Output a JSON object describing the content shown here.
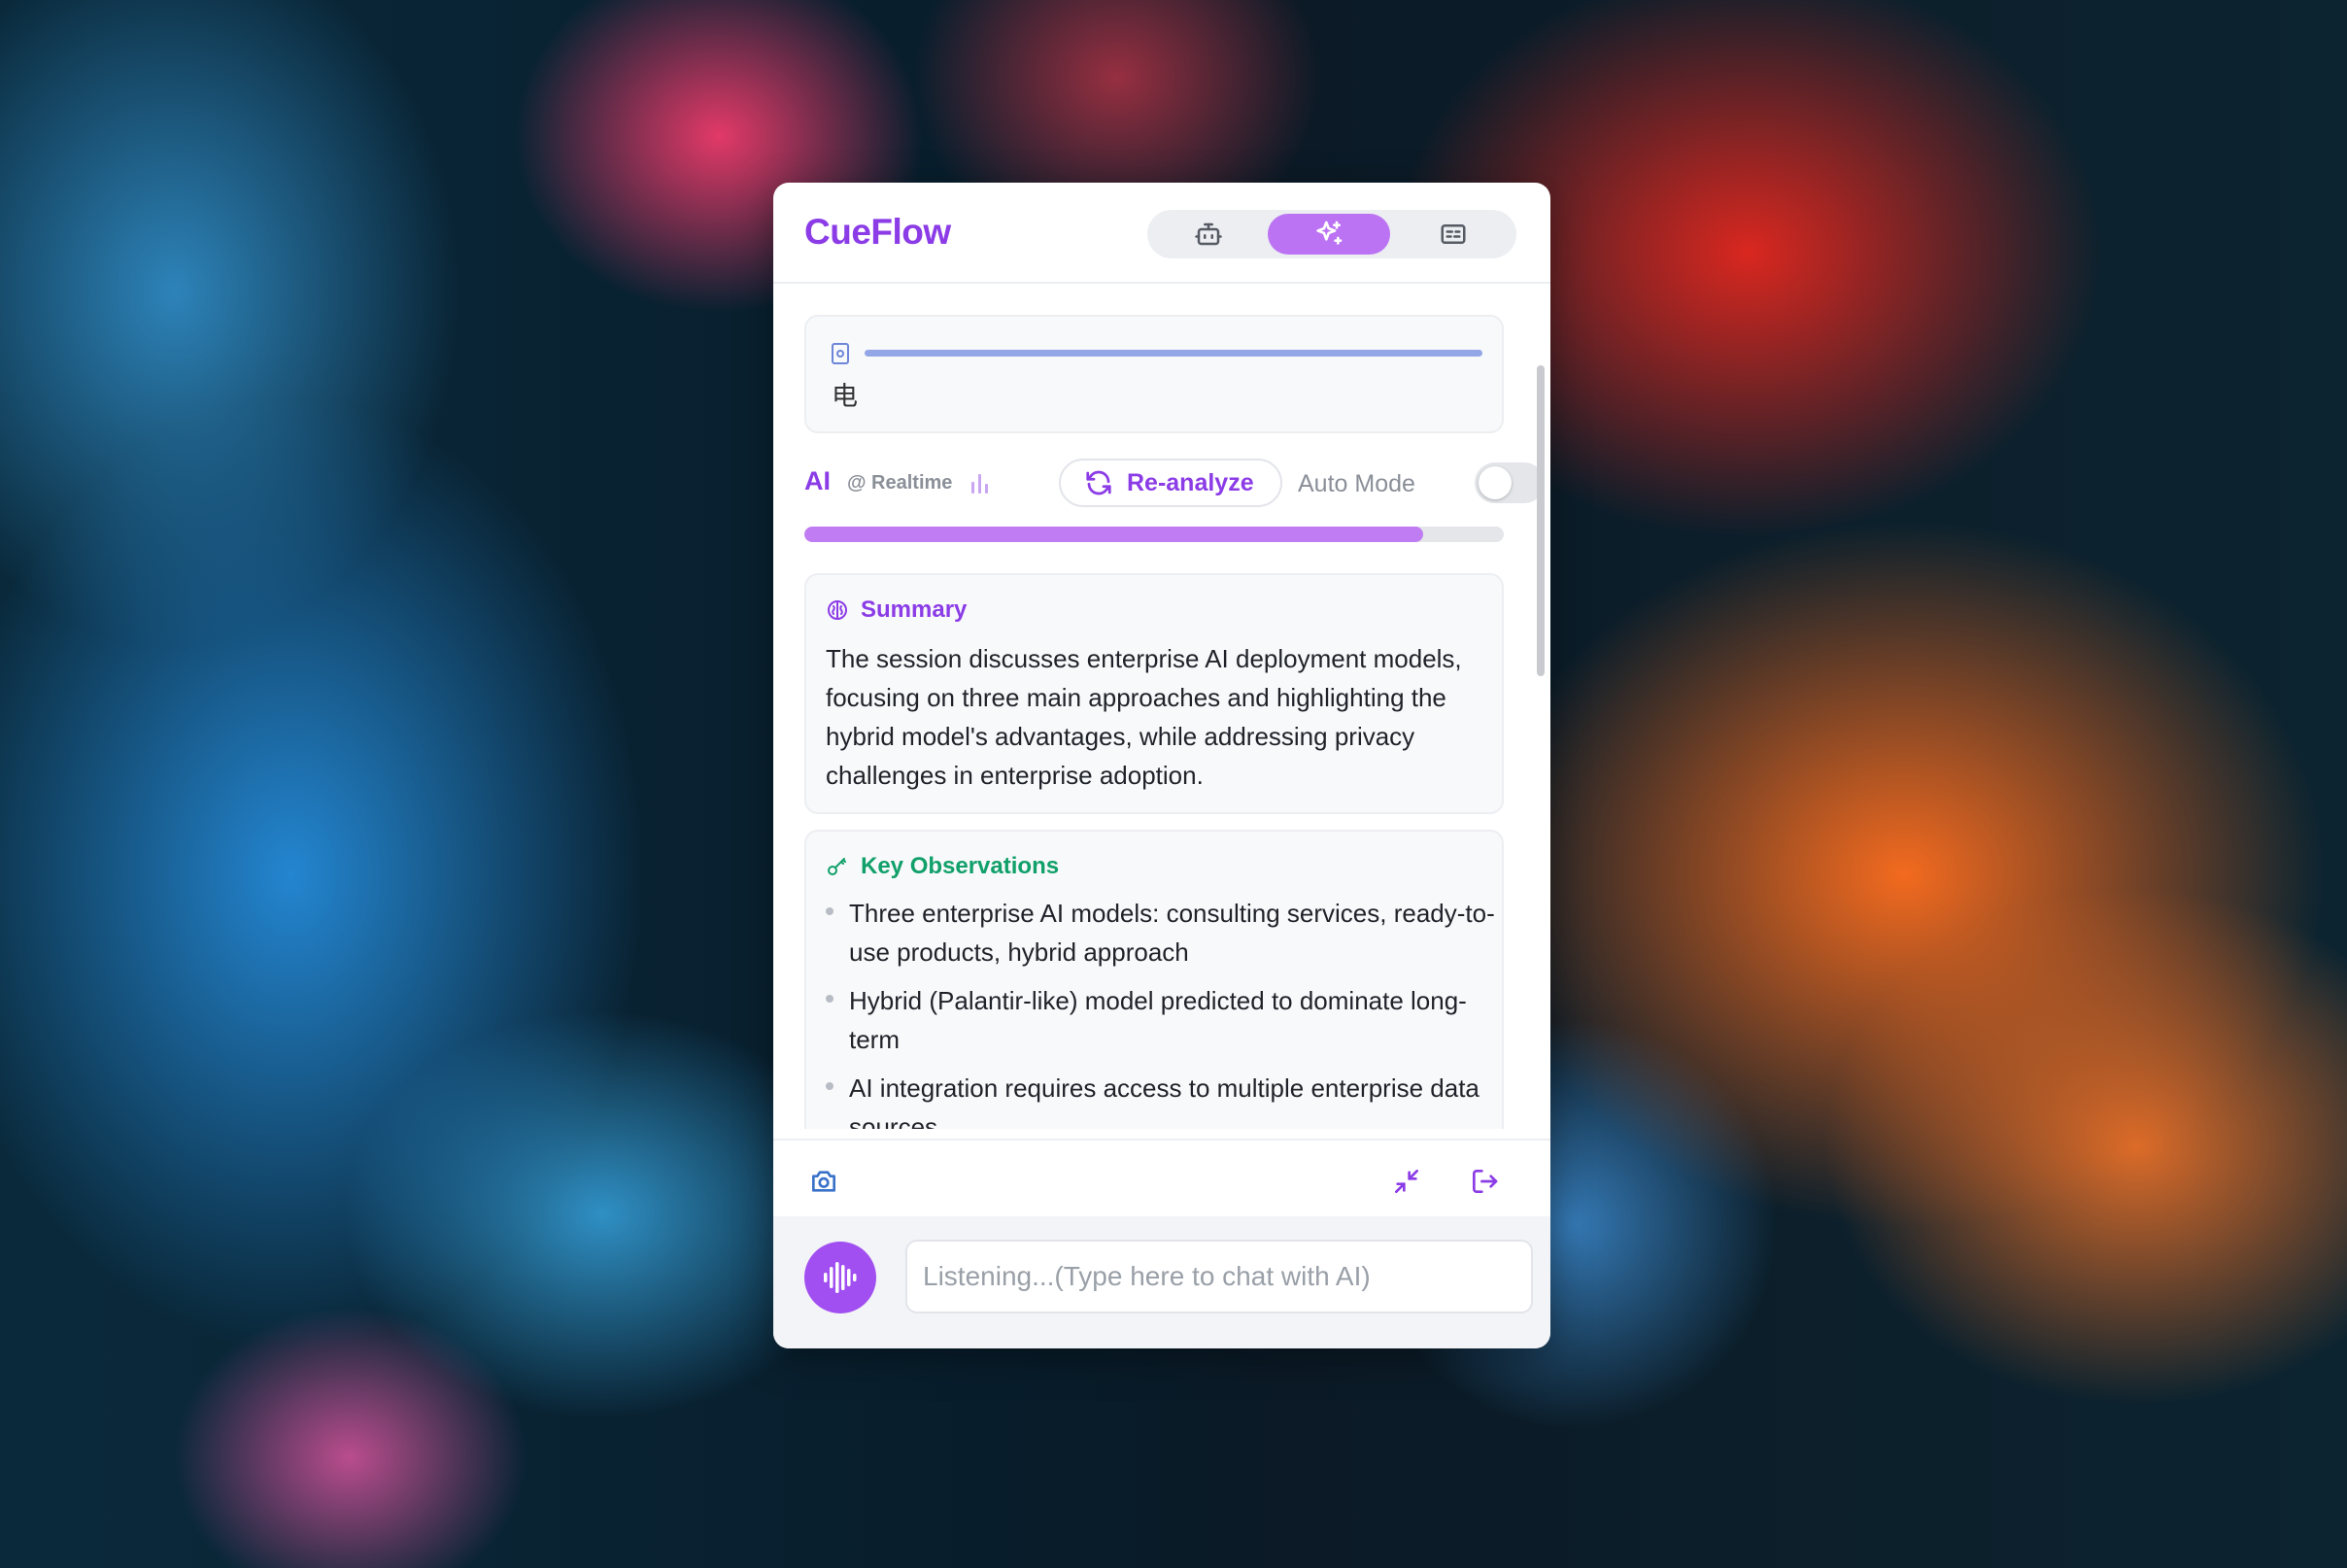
{
  "app": {
    "title": "CueFlow"
  },
  "header": {
    "modes": [
      {
        "icon": "robot-icon"
      },
      {
        "icon": "sparkles-icon"
      },
      {
        "icon": "captions-icon"
      }
    ],
    "active_mode": 1
  },
  "source": {
    "icon": "document-icon",
    "text": "电"
  },
  "ai_bar": {
    "label": "AI",
    "realtime_label": "@ Realtime",
    "signal_icon": "bar-signal-icon",
    "reanalyze_label": "Re-analyze",
    "auto_mode_label": "Auto Mode",
    "auto_mode_on": false
  },
  "progress": {
    "value": 0.885
  },
  "summary": {
    "icon": "brain-icon",
    "title": "Summary",
    "text": "The session discusses enterprise AI deployment models, focusing on three main approaches and highlighting the hybrid model's advantages, while addressing privacy challenges in enterprise adoption."
  },
  "observations": {
    "icon": "key-icon",
    "title": "Key Observations",
    "items": [
      "Three enterprise AI models: consulting services, ready-to-use products, hybrid approach",
      "Hybrid (Palantir-like) model predicted to dominate long-term",
      "AI integration requires access to multiple enterprise data sources"
    ]
  },
  "toolbar": {
    "camera_icon": "camera-icon",
    "collapse_icon": "minimize-icon",
    "exit_icon": "exit-icon"
  },
  "input": {
    "placeholder": "Listening...(Type here to chat with AI)",
    "value": ""
  },
  "colors": {
    "brand": "#8b3ce6",
    "accent": "#bb73f3",
    "success": "#11a06a",
    "progress": "#c07cf2"
  }
}
